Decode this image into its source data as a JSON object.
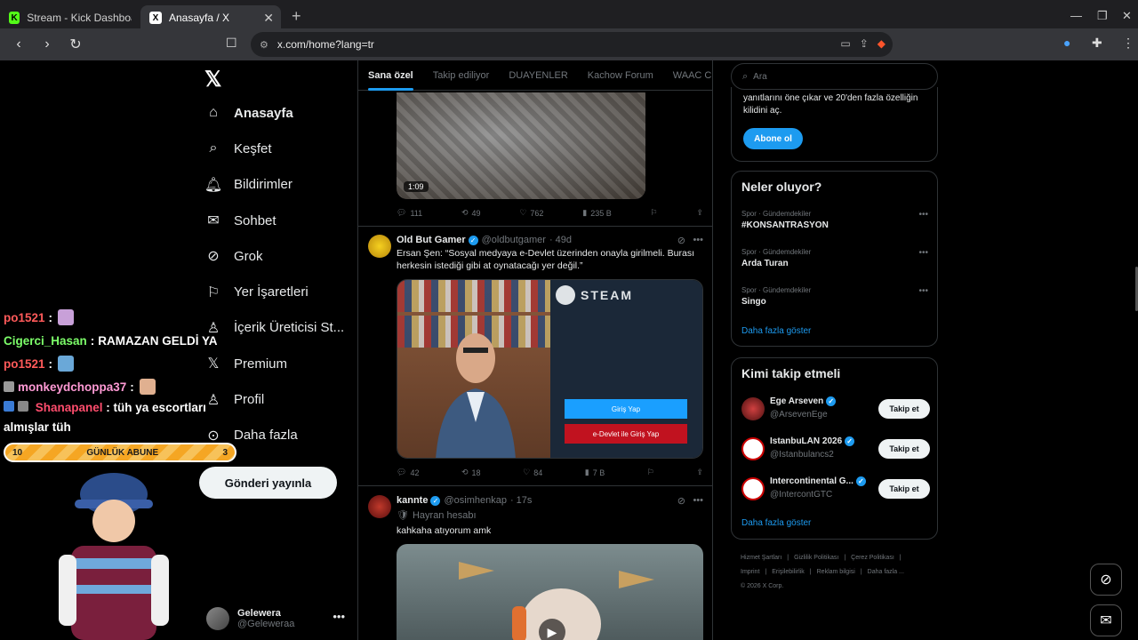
{
  "browser": {
    "tabs": [
      {
        "label": "Stream - Kick Dashboard",
        "favicon": "kick-icon"
      },
      {
        "label": "Anasayfa / X",
        "favicon": "x-icon"
      }
    ],
    "url": "x.com/home?lang=tr"
  },
  "stream": {
    "chat": [
      {
        "user": "po1521",
        "color": "#ff5a5a",
        "text": ""
      },
      {
        "user": "Cigerci_Hasan",
        "color": "#7dff6a",
        "text": "RAMAZAN GELDİ YA"
      },
      {
        "user": "po1521",
        "color": "#ff5a5a",
        "text": ""
      },
      {
        "user": "monkeydchoppa37",
        "color": "#ff9ad5",
        "text": ""
      },
      {
        "user": "Shanapanel",
        "color": "#ff4d6d",
        "text": "tüh ya escortları almışlar tüh"
      }
    ],
    "sub_goal": {
      "left": "10",
      "label": "GÜNLÜK ABUNE",
      "right": "3"
    }
  },
  "x_nav": {
    "items": [
      {
        "label": "Anasayfa",
        "icon": "home-icon"
      },
      {
        "label": "Keşfet",
        "icon": "search-icon"
      },
      {
        "label": "Bildirimler",
        "icon": "bell-icon"
      },
      {
        "label": "Sohbet",
        "icon": "mail-icon"
      },
      {
        "label": "Grok",
        "icon": "grok-icon"
      },
      {
        "label": "Yer İşaretleri",
        "icon": "bookmark-icon"
      },
      {
        "label": "İçerik Üreticisi St...",
        "icon": "creator-icon"
      },
      {
        "label": "Premium",
        "icon": "x-logo-icon"
      },
      {
        "label": "Profil",
        "icon": "person-icon"
      },
      {
        "label": "Daha fazla",
        "icon": "more-circle-icon"
      }
    ],
    "post_button": "Gönderi yayınla",
    "profile": {
      "name": "Gelewera",
      "handle": "@Geleweraa"
    }
  },
  "feed": {
    "tabs": [
      "Sana özel",
      "Takip ediliyor",
      "DUAYENLER",
      "Kachow Forum",
      "WAAC Club"
    ],
    "tweet1": {
      "duration": "1:09",
      "replies": "111",
      "reposts": "49",
      "likes": "762",
      "views": "235 B"
    },
    "tweet2": {
      "name": "Old But Gamer",
      "handle": "@oldbutgamer",
      "time": "· 49d",
      "text": "Ersan Şen: “Sosyal medyaya e-Devlet üzerinden onayla girilmeli. Burası herkesin istediği gibi at oynatacağı yer değil.”",
      "steam": "STEAM",
      "steam_login": "Giriş Yap",
      "steam_edevlet": "e-Devlet ile Giriş Yap",
      "replies": "42",
      "reposts": "18",
      "likes": "84",
      "views": "7 B"
    },
    "tweet3": {
      "name": "kannte",
      "handle": "@osimhenkap",
      "time": "· 17s",
      "subtitle": "Hayran hesabı",
      "text": "kahkaha atıyorum amk"
    }
  },
  "right": {
    "search_placeholder": "Ara",
    "premium_text": "yanıtlarını öne çıkar ve 20'den fazla özelliğin kilidini aç.",
    "subscribe": "Abone ol",
    "trends_title": "Neler oluyor?",
    "trends": [
      {
        "category": "Spor · Gündemdekiler",
        "name": "#KONSANTRASYON"
      },
      {
        "category": "Spor · Gündemdekiler",
        "name": "Arda Turan"
      },
      {
        "category": "Spor · Gündemdekiler",
        "name": "Singo"
      }
    ],
    "show_more": "Daha fazla göster",
    "follow_title": "Kimi takip etmeli",
    "follow_button": "Takip et",
    "suggestions": [
      {
        "name": "Ege Arseven",
        "handle": "@ArsevenEge"
      },
      {
        "name": "IstanbuLAN 2026",
        "handle": "@Istanbulancs2"
      },
      {
        "name": "Intercontinental G...",
        "handle": "@IntercontGTC"
      }
    ],
    "footer": [
      "Hizmet Şartları",
      "|",
      "Gizlilik Politikası",
      "|",
      "Çerez Politikası",
      "|",
      "Imprint",
      "|",
      "Erişilebilirlik",
      "|",
      "Reklam bilgisi",
      "|",
      "Daha fazla ...",
      "© 2026 X Corp."
    ]
  }
}
